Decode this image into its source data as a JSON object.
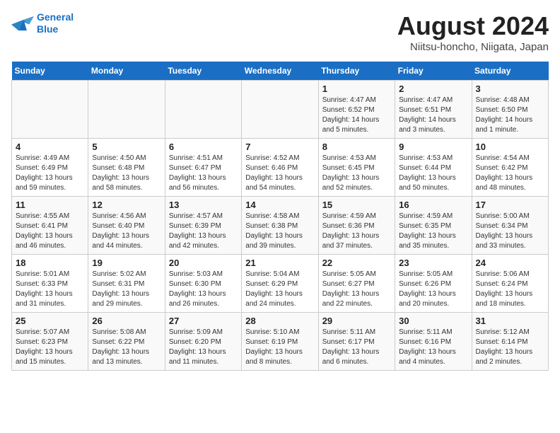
{
  "logo": {
    "line1": "General",
    "line2": "Blue"
  },
  "title": "August 2024",
  "subtitle": "Niitsu-honcho, Niigata, Japan",
  "days_of_week": [
    "Sunday",
    "Monday",
    "Tuesday",
    "Wednesday",
    "Thursday",
    "Friday",
    "Saturday"
  ],
  "weeks": [
    [
      {
        "day": "",
        "info": ""
      },
      {
        "day": "",
        "info": ""
      },
      {
        "day": "",
        "info": ""
      },
      {
        "day": "",
        "info": ""
      },
      {
        "day": "1",
        "info": "Sunrise: 4:47 AM\nSunset: 6:52 PM\nDaylight: 14 hours\nand 5 minutes."
      },
      {
        "day": "2",
        "info": "Sunrise: 4:47 AM\nSunset: 6:51 PM\nDaylight: 14 hours\nand 3 minutes."
      },
      {
        "day": "3",
        "info": "Sunrise: 4:48 AM\nSunset: 6:50 PM\nDaylight: 14 hours\nand 1 minute."
      }
    ],
    [
      {
        "day": "4",
        "info": "Sunrise: 4:49 AM\nSunset: 6:49 PM\nDaylight: 13 hours\nand 59 minutes."
      },
      {
        "day": "5",
        "info": "Sunrise: 4:50 AM\nSunset: 6:48 PM\nDaylight: 13 hours\nand 58 minutes."
      },
      {
        "day": "6",
        "info": "Sunrise: 4:51 AM\nSunset: 6:47 PM\nDaylight: 13 hours\nand 56 minutes."
      },
      {
        "day": "7",
        "info": "Sunrise: 4:52 AM\nSunset: 6:46 PM\nDaylight: 13 hours\nand 54 minutes."
      },
      {
        "day": "8",
        "info": "Sunrise: 4:53 AM\nSunset: 6:45 PM\nDaylight: 13 hours\nand 52 minutes."
      },
      {
        "day": "9",
        "info": "Sunrise: 4:53 AM\nSunset: 6:44 PM\nDaylight: 13 hours\nand 50 minutes."
      },
      {
        "day": "10",
        "info": "Sunrise: 4:54 AM\nSunset: 6:42 PM\nDaylight: 13 hours\nand 48 minutes."
      }
    ],
    [
      {
        "day": "11",
        "info": "Sunrise: 4:55 AM\nSunset: 6:41 PM\nDaylight: 13 hours\nand 46 minutes."
      },
      {
        "day": "12",
        "info": "Sunrise: 4:56 AM\nSunset: 6:40 PM\nDaylight: 13 hours\nand 44 minutes."
      },
      {
        "day": "13",
        "info": "Sunrise: 4:57 AM\nSunset: 6:39 PM\nDaylight: 13 hours\nand 42 minutes."
      },
      {
        "day": "14",
        "info": "Sunrise: 4:58 AM\nSunset: 6:38 PM\nDaylight: 13 hours\nand 39 minutes."
      },
      {
        "day": "15",
        "info": "Sunrise: 4:59 AM\nSunset: 6:36 PM\nDaylight: 13 hours\nand 37 minutes."
      },
      {
        "day": "16",
        "info": "Sunrise: 4:59 AM\nSunset: 6:35 PM\nDaylight: 13 hours\nand 35 minutes."
      },
      {
        "day": "17",
        "info": "Sunrise: 5:00 AM\nSunset: 6:34 PM\nDaylight: 13 hours\nand 33 minutes."
      }
    ],
    [
      {
        "day": "18",
        "info": "Sunrise: 5:01 AM\nSunset: 6:33 PM\nDaylight: 13 hours\nand 31 minutes."
      },
      {
        "day": "19",
        "info": "Sunrise: 5:02 AM\nSunset: 6:31 PM\nDaylight: 13 hours\nand 29 minutes."
      },
      {
        "day": "20",
        "info": "Sunrise: 5:03 AM\nSunset: 6:30 PM\nDaylight: 13 hours\nand 26 minutes."
      },
      {
        "day": "21",
        "info": "Sunrise: 5:04 AM\nSunset: 6:29 PM\nDaylight: 13 hours\nand 24 minutes."
      },
      {
        "day": "22",
        "info": "Sunrise: 5:05 AM\nSunset: 6:27 PM\nDaylight: 13 hours\nand 22 minutes."
      },
      {
        "day": "23",
        "info": "Sunrise: 5:05 AM\nSunset: 6:26 PM\nDaylight: 13 hours\nand 20 minutes."
      },
      {
        "day": "24",
        "info": "Sunrise: 5:06 AM\nSunset: 6:24 PM\nDaylight: 13 hours\nand 18 minutes."
      }
    ],
    [
      {
        "day": "25",
        "info": "Sunrise: 5:07 AM\nSunset: 6:23 PM\nDaylight: 13 hours\nand 15 minutes."
      },
      {
        "day": "26",
        "info": "Sunrise: 5:08 AM\nSunset: 6:22 PM\nDaylight: 13 hours\nand 13 minutes."
      },
      {
        "day": "27",
        "info": "Sunrise: 5:09 AM\nSunset: 6:20 PM\nDaylight: 13 hours\nand 11 minutes."
      },
      {
        "day": "28",
        "info": "Sunrise: 5:10 AM\nSunset: 6:19 PM\nDaylight: 13 hours\nand 8 minutes."
      },
      {
        "day": "29",
        "info": "Sunrise: 5:11 AM\nSunset: 6:17 PM\nDaylight: 13 hours\nand 6 minutes."
      },
      {
        "day": "30",
        "info": "Sunrise: 5:11 AM\nSunset: 6:16 PM\nDaylight: 13 hours\nand 4 minutes."
      },
      {
        "day": "31",
        "info": "Sunrise: 5:12 AM\nSunset: 6:14 PM\nDaylight: 13 hours\nand 2 minutes."
      }
    ]
  ]
}
